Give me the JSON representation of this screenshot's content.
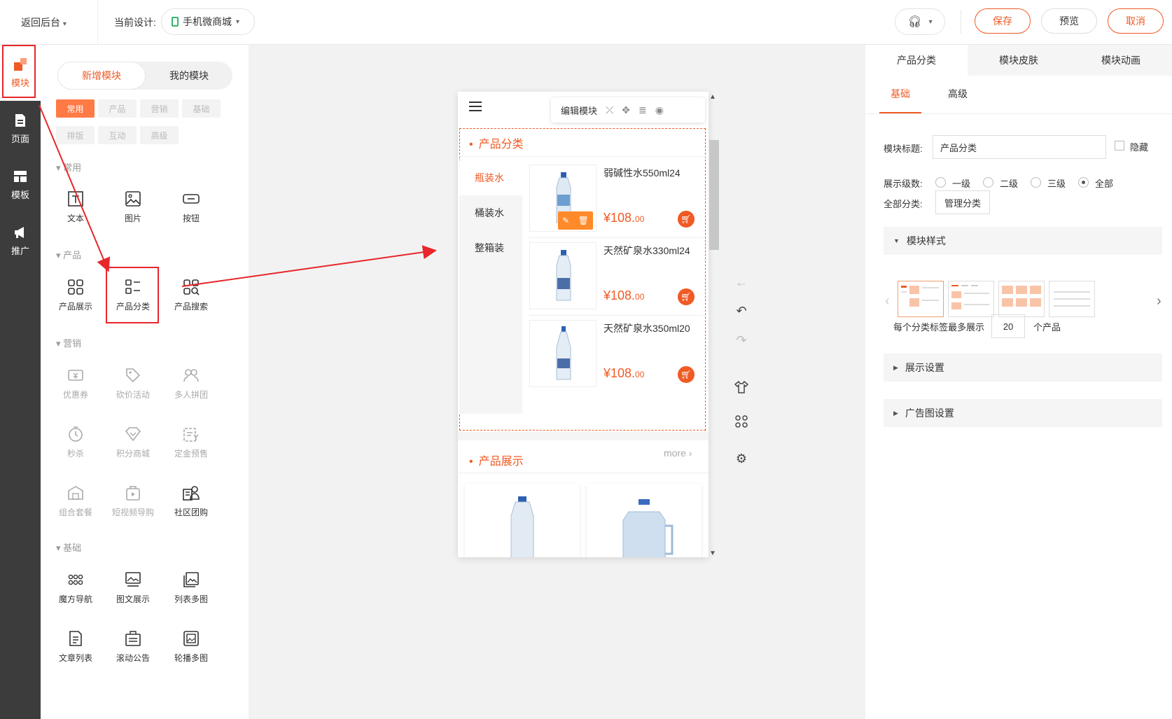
{
  "topbar": {
    "back": "返回后台",
    "current_design_label": "当前设计:",
    "current_design_value": "手机微商城",
    "save": "保存",
    "preview": "预览",
    "cancel": "取消"
  },
  "rail": [
    {
      "label": "模块",
      "icon": "module-icon"
    },
    {
      "label": "页面",
      "icon": "page-icon"
    },
    {
      "label": "模板",
      "icon": "template-icon"
    },
    {
      "label": "推广",
      "icon": "megaphone-icon"
    }
  ],
  "panel": {
    "tab_new": "新增模块",
    "tab_mine": "我的模块",
    "chips": [
      "常用",
      "产品",
      "营销",
      "基础",
      "排版",
      "互动",
      "高级"
    ],
    "sections": {
      "common": {
        "title": "常用",
        "items": [
          "文本",
          "图片",
          "按钮"
        ]
      },
      "product": {
        "title": "产品",
        "items": [
          "产品展示",
          "产品分类",
          "产品搜索"
        ]
      },
      "marketing": {
        "title": "营销",
        "items": [
          "优惠券",
          "砍价活动",
          "多人拼团",
          "秒杀",
          "积分商城",
          "定金预售",
          "组合套餐",
          "短视频导购",
          "社区团购"
        ]
      },
      "basic": {
        "title": "基础",
        "items": [
          "魔方导航",
          "图文展示",
          "列表多图",
          "文章列表",
          "滚动公告",
          "轮播多图"
        ]
      }
    }
  },
  "phone": {
    "edit_module": "编辑模块",
    "category_title": "产品分类",
    "categories": [
      "瓶装水",
      "桶装水",
      "整箱装"
    ],
    "products": [
      {
        "name": "弱碱性水550ml24",
        "price_main": "¥108.",
        "price_dec": "00"
      },
      {
        "name": "天然矿泉水330ml24",
        "price_main": "¥108.",
        "price_dec": "00"
      },
      {
        "name": "天然矿泉水350ml20",
        "price_main": "¥108.",
        "price_dec": "00"
      }
    ],
    "show_title": "产品展示",
    "more": "more"
  },
  "right": {
    "tabs": [
      "产品分类",
      "模块皮肤",
      "模块动画"
    ],
    "subtabs": [
      "基础",
      "高级"
    ],
    "title_label": "模块标题:",
    "title_value": "产品分类",
    "hide_label": "隐藏",
    "levels_label": "展示级数:",
    "levels": [
      "一级",
      "二级",
      "三级",
      "全部"
    ],
    "all_cat_label": "全部分类:",
    "manage_btn": "管理分类",
    "style_section": "模块样式",
    "max_prefix": "每个分类标签最多展示",
    "max_value": "20",
    "max_suffix": "个产品",
    "display_settings": "展示设置",
    "ad_settings": "广告图设置"
  },
  "colors": {
    "accent": "#f05a24",
    "highlight": "#e8262b",
    "rail": "#3c3c3c"
  }
}
